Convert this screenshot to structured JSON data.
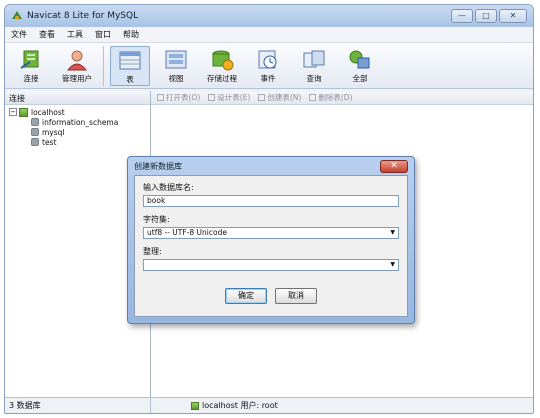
{
  "window": {
    "title": "Navicat 8 Lite for MySQL"
  },
  "menu": [
    "文件",
    "查看",
    "工具",
    "窗口",
    "帮助"
  ],
  "toolbar": {
    "connect": "连接",
    "users": "管理用户",
    "table": "表",
    "view": "视图",
    "procedure": "存储过程",
    "event": "事件",
    "query": "查询",
    "all": "全部"
  },
  "left_panel": {
    "header": "连接",
    "server": "localhost",
    "databases": [
      "information_schema",
      "mysql",
      "test"
    ]
  },
  "object_toolbar": {
    "open": "打开表(O)",
    "design": "设计表(E)",
    "create": "创建表(N)",
    "delete": "删除表(D)"
  },
  "status": {
    "count": "3 数据库",
    "connection": "localhost  用户: root"
  },
  "dialog": {
    "title": "创建新数据库",
    "name_label": "输入数据库名:",
    "name_value": "book",
    "charset_label": "字符集:",
    "charset_value": "utf8 -- UTF-8 Unicode",
    "collation_label": "整理:",
    "collation_value": "",
    "ok": "确定",
    "cancel": "取消"
  }
}
